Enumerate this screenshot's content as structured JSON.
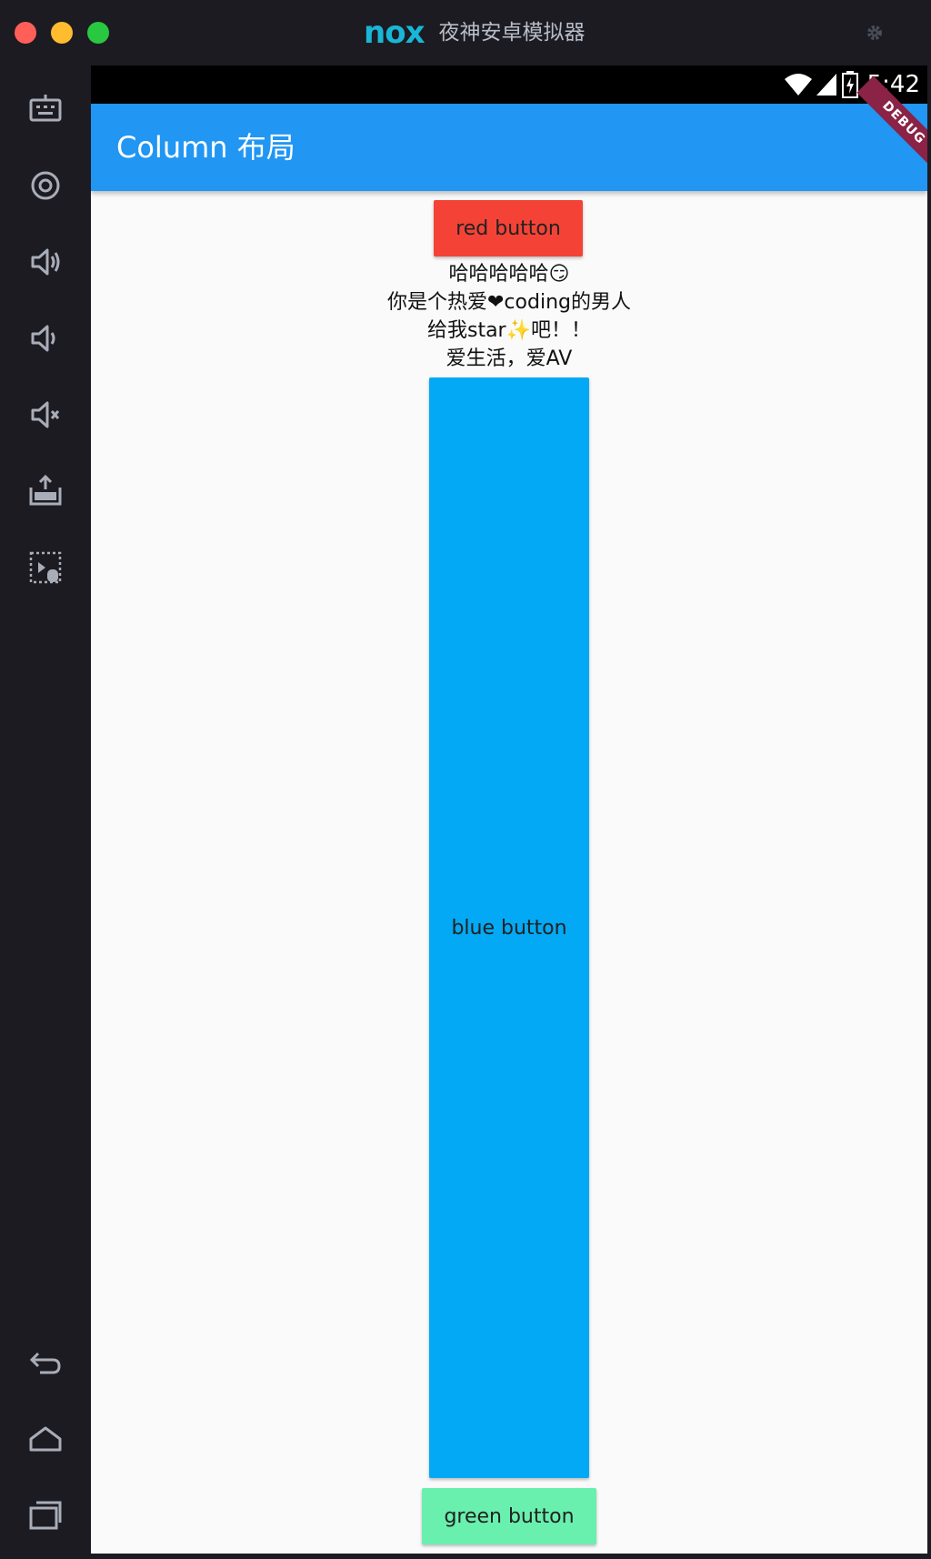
{
  "window": {
    "brand_logo": "nox",
    "brand_name": "夜神安卓模拟器"
  },
  "sidebar": {
    "items": [
      {
        "icon": "keyboard-icon"
      },
      {
        "icon": "location-icon"
      },
      {
        "icon": "volume-up-icon"
      },
      {
        "icon": "volume-down-icon"
      },
      {
        "icon": "mute-icon"
      },
      {
        "icon": "apk-install-icon"
      },
      {
        "icon": "macro-icon"
      },
      {
        "icon": "back-icon"
      },
      {
        "icon": "home-icon"
      },
      {
        "icon": "recent-apps-icon"
      }
    ]
  },
  "status_bar": {
    "time": "5:42"
  },
  "app_bar": {
    "title": "Column 布局",
    "debug_banner": "DEBUG"
  },
  "content": {
    "red_button_label": "red button",
    "text_lines": [
      "哈哈哈哈哈😏",
      "你是个热爱❤coding的男人",
      "给我star✨吧！！",
      "爱生活，爱AV"
    ],
    "blue_button_label": "blue button",
    "green_button_label": "green button"
  },
  "colors": {
    "traffic_close": "#ff5f57",
    "traffic_min": "#febc2e",
    "traffic_max": "#28c840",
    "brand_accent": "#19b6d6",
    "app_bar": "#2196f3",
    "red_button": "#f44336",
    "blue_button": "#03a9f4",
    "green_button": "#69f0ae",
    "debug_banner": "#8a2346"
  }
}
